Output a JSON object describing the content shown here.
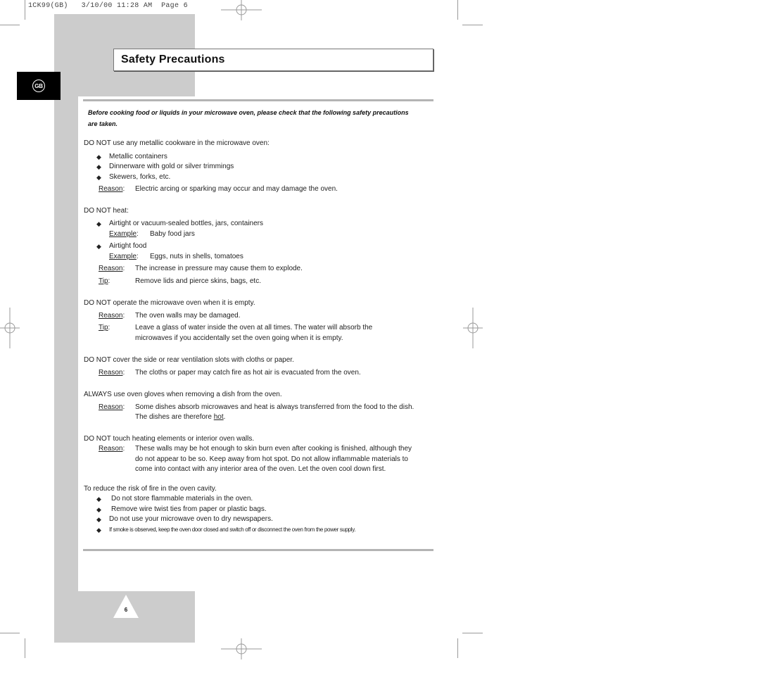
{
  "header_slug": {
    "code": "1CK99(GB)",
    "date": "3/10/00",
    "time": "11:28 AM",
    "page": "Page 6"
  },
  "language_tab": "GB",
  "title": "Safety Precautions",
  "intro": "Before cooking food or liquids in your microwave oven, please check that the following safety precautions are taken.",
  "labels": {
    "reason": "Reason",
    "tip": "Tip",
    "example": "Example"
  },
  "sections": [
    {
      "heading": "DO NOT use any metallic cookware in the microwave oven:",
      "bullets": [
        "Metallic containers",
        "Dinnerware with gold or silver trimmings",
        "Skewers, forks, etc."
      ],
      "reason": "Electric arcing or sparking may occur and may damage the oven."
    },
    {
      "heading": "DO NOT heat:",
      "bullets": [
        {
          "text": "Airtight or vacuum-sealed bottles, jars, containers",
          "example": "Baby food jars"
        },
        {
          "text": "Airtight food",
          "example": "Eggs, nuts in shells, tomatoes"
        }
      ],
      "reason": "The increase in pressure may cause them to explode.",
      "tip": "Remove lids and pierce skins, bags, etc."
    },
    {
      "heading": "DO NOT operate the microwave oven when it is empty.",
      "reason": "The oven walls may be damaged.",
      "tip_line1": "Leave a glass of water inside the oven at all times. The water will absorb the",
      "tip_line2": "microwaves if you accidentally set the oven going when it is empty."
    },
    {
      "heading": "DO NOT cover the side or rear ventilation slots with cloths or paper.",
      "reason": "The cloths or paper may catch fire as hot air is evacuated from the oven."
    },
    {
      "heading": "ALWAYS use oven gloves when removing a dish from the oven.",
      "reason_line1": "Some dishes absorb microwaves and heat is always transferred from the food to the dish.",
      "reason_line2_pre": "The dishes are therefore ",
      "reason_line2_u": "hot",
      "reason_line2_post": "."
    },
    {
      "heading": "DO NOT touch heating elements or interior oven walls.",
      "reason_line1": "These walls may be hot enough to skin burn even after cooking is finished, although they",
      "reason_line2": "do not appear to be so. Keep away from hot spot. Do not allow inflammable materials to",
      "reason_line3": "come into contact with any interior area of the oven. Let the oven cool down first."
    },
    {
      "heading": "To reduce the risk of fire in the oven cavity.",
      "bullets": [
        "Do not store flammable materials in the oven.",
        "Remove wire twist ties from paper or plastic bags.",
        "Do not use your microwave oven to dry newspapers.",
        "If smoke is observed, keep the oven door closed and switch off or disconnect the oven from the power supply."
      ]
    }
  ],
  "page_number": "6",
  "bullet_glyph": "◆",
  "colors": {
    "panel_gray": "#cccccc",
    "rule_gray": "#b4b4b4",
    "tab_black": "#000000"
  }
}
